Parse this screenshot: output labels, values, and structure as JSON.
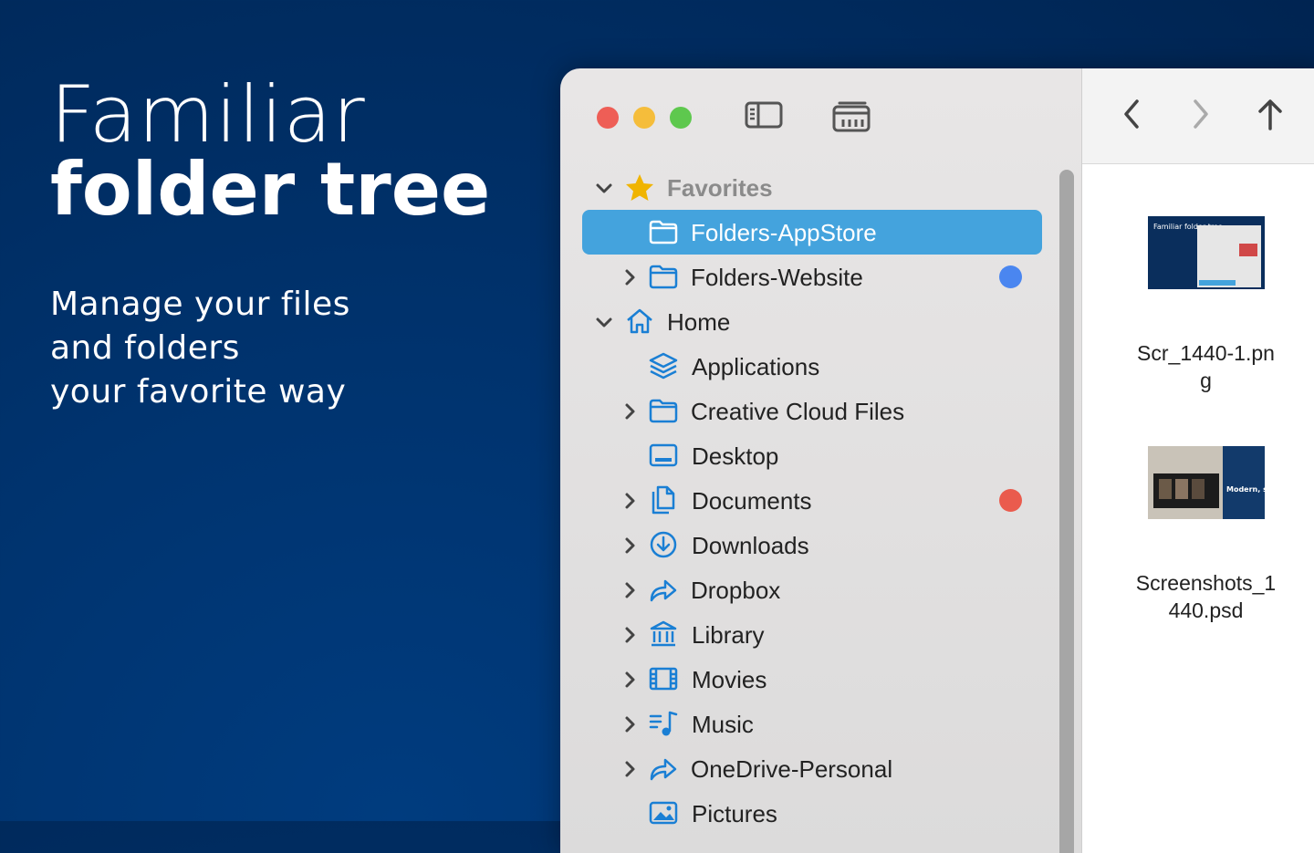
{
  "promo": {
    "title_light": "Familiar",
    "title_bold": "folder tree",
    "subtitle_lines": [
      "Manage your files",
      "and folders",
      "your favorite way"
    ]
  },
  "sidebar": {
    "favorites_label": "Favorites",
    "items": [
      {
        "label": "Folders-AppStore",
        "icon": "folder-icon",
        "selected": true
      },
      {
        "label": "Folders-Website",
        "icon": "folder-icon",
        "tag": "#4a86f0"
      },
      {
        "label": "Home",
        "icon": "home-icon"
      },
      {
        "label": "Applications",
        "icon": "applications-icon"
      },
      {
        "label": "Creative Cloud Files",
        "icon": "folder-icon"
      },
      {
        "label": "Desktop",
        "icon": "desktop-icon"
      },
      {
        "label": "Documents",
        "icon": "documents-icon",
        "tag": "#ea5b4d"
      },
      {
        "label": "Downloads",
        "icon": "downloads-icon"
      },
      {
        "label": "Dropbox",
        "icon": "share-icon"
      },
      {
        "label": "Library",
        "icon": "library-icon"
      },
      {
        "label": "Movies",
        "icon": "film-icon"
      },
      {
        "label": "Music",
        "icon": "music-icon"
      },
      {
        "label": "OneDrive-Personal",
        "icon": "share-icon"
      },
      {
        "label": "Pictures",
        "icon": "pictures-icon"
      }
    ]
  },
  "files": [
    {
      "name_line1": "Scr_1440-1.pn",
      "name_line2": "g",
      "thumb_title": "Familiar folder tree"
    },
    {
      "name_line1": "Screenshots_1",
      "name_line2": "440.psd",
      "thumb_title": "Modern, sleek"
    }
  ],
  "colors": {
    "accent": "#44a3dd",
    "icon_blue": "#1a7fd4"
  }
}
